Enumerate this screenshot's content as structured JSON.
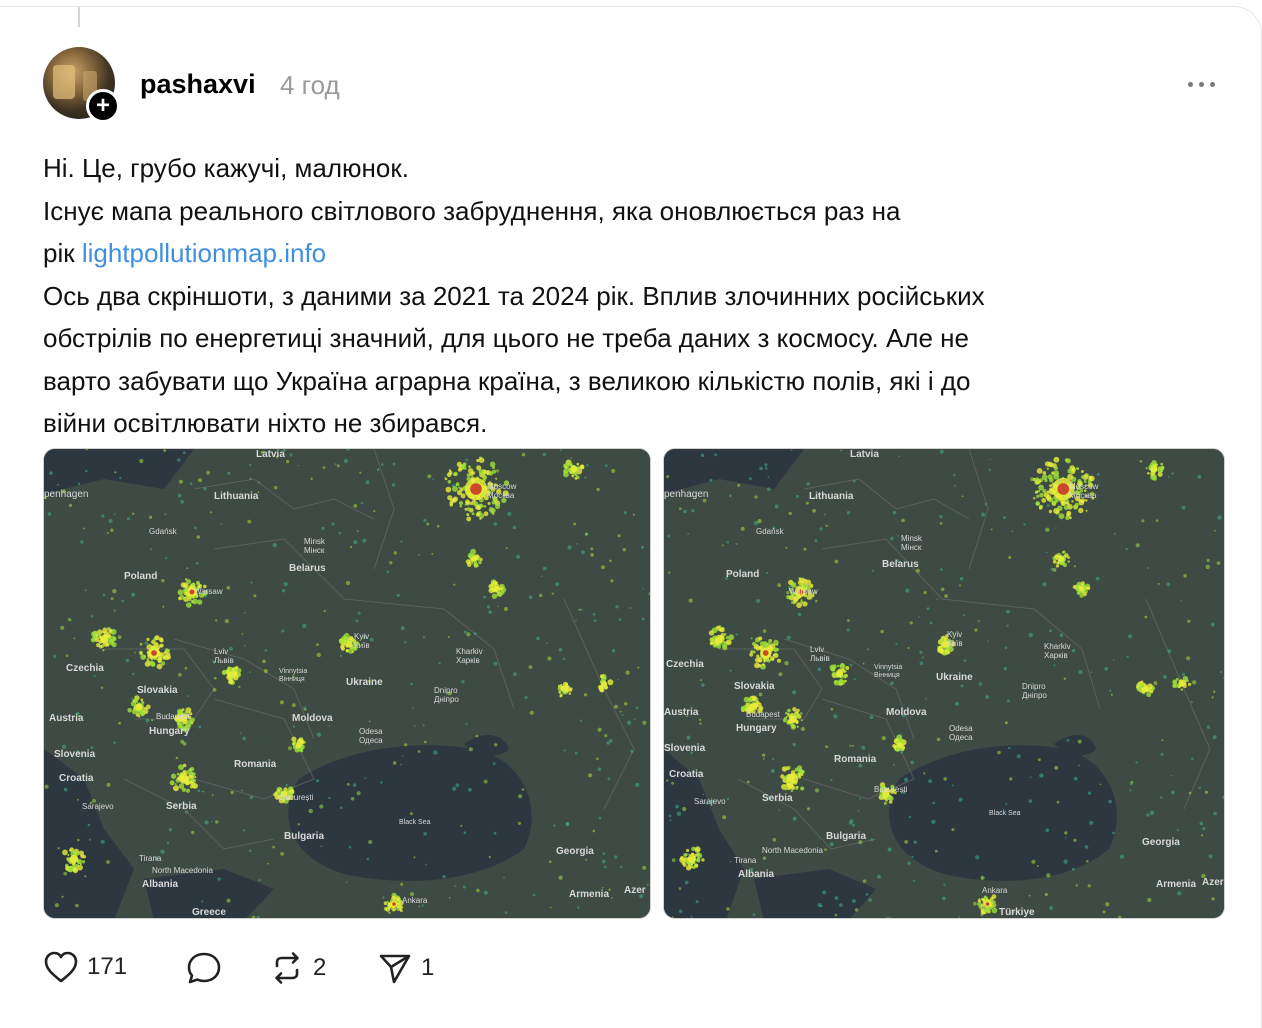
{
  "post": {
    "username": "pashaxvi",
    "time": "4 год",
    "follow_symbol": "+",
    "lines": [
      "Ні. Це, грубо кажучі, малюнок.",
      "Існує мапа реального світлового забруднення, яка оновлюється раз на",
      "рік",
      "Ось два скріншоти, з даними за 2021 та 2024 рік. Вплив злочинних російських",
      "обстрілів по енергетиці значний, для цього не треба даних з космосу. Але не",
      "варто забувати що Україна аграрна країна, з великою кількістю полів, які і до",
      "війни освітлювати ніхто не збирався."
    ],
    "link_text": "lightpollutionmap.info"
  },
  "map_labels": {
    "latvia": "Latvia",
    "lithuania": "Lithuania",
    "copenhagen": "penhagen",
    "moscow": "Moscow",
    "moscow_local": "Москва",
    "minsk": "Minsk",
    "minsk_local": "Мінск",
    "belarus": "Belarus",
    "poland": "Poland",
    "warsaw": "Warsaw",
    "gdansk": "Gdańsk",
    "kyiv": "Kyiv",
    "kyiv_local": "Київ",
    "lviv": "Lviv",
    "lviv_local": "Львів",
    "vinnytsia": "Vinnytsia",
    "vinnytsia_local": "Вінниця",
    "kharkiv": "Kharkiv",
    "kharkiv_local": "Харків",
    "ukraine": "Ukraine",
    "dnipro": "Dnipro",
    "dnipro_local": "Дніпро",
    "czechia": "Czechia",
    "slovakia": "Slovakia",
    "austria": "Austria",
    "hungary": "Hungary",
    "budapest": "Budapest",
    "moldova": "Moldova",
    "odesa": "Odesa",
    "odesa_local": "Одеса",
    "romania": "Romania",
    "bucharest": "București",
    "croatia": "Croatia",
    "slovenia": "Slovenia",
    "serbia": "Serbia",
    "sarajevo": "Sarajevo",
    "bulgaria": "Bulgaria",
    "black_sea": "Black Sea",
    "georgia": "Georgia",
    "armenia": "Armenia",
    "azerbaijan": "Azer",
    "tirana": "Tirana",
    "albania": "Albania",
    "north_macedonia": "North Macedonia",
    "greece": "Greece",
    "ankara": "Ankara",
    "turkiye": "Türkiye"
  },
  "actions": {
    "likes": "171",
    "reposts": "2",
    "shares": "1"
  },
  "colors": {
    "link": "#3f8fe0",
    "land": "#3e4a44",
    "sea": "#2c3740",
    "light_low": "#3fae88",
    "light_mid": "#9fe03a",
    "light_high": "#e9ec3a",
    "light_core": "#c8362e"
  }
}
